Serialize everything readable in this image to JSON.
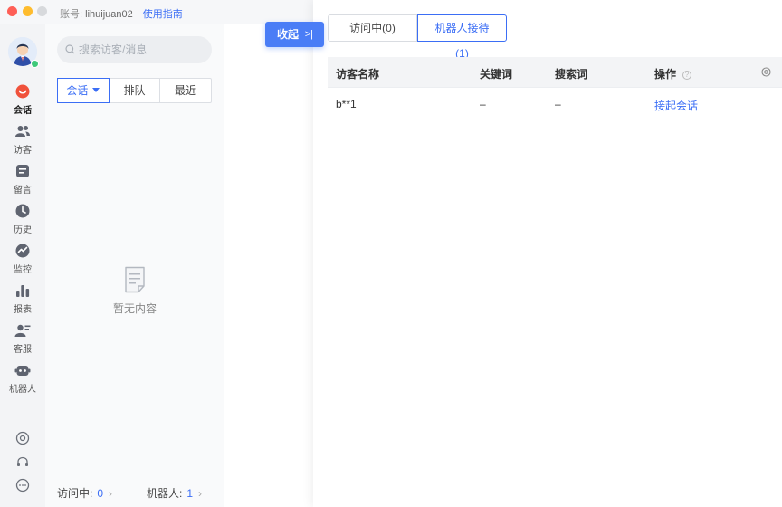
{
  "titlebar": {
    "account_label": "账号:",
    "account_name": "lihuijuan02",
    "guide": "使用指南"
  },
  "nav": {
    "items": [
      {
        "label": "会话",
        "icon": "chat-icon"
      },
      {
        "label": "访客",
        "icon": "visitors-icon"
      },
      {
        "label": "留言",
        "icon": "message-icon"
      },
      {
        "label": "历史",
        "icon": "history-icon"
      },
      {
        "label": "监控",
        "icon": "monitor-icon"
      },
      {
        "label": "报表",
        "icon": "report-icon"
      },
      {
        "label": "客服",
        "icon": "agent-icon"
      },
      {
        "label": "机器人",
        "icon": "robot-icon"
      }
    ],
    "bottom_icons": [
      "settings-icon",
      "headset-icon",
      "more-icon"
    ]
  },
  "list": {
    "search_placeholder": "搜索访客/消息",
    "tabs": [
      "会话",
      "排队",
      "最近"
    ],
    "empty_text": "暂无内容",
    "footer": {
      "visiting_label": "访问中:",
      "visiting_count": "0",
      "robot_label": "机器人:",
      "robot_count": "1"
    }
  },
  "collapse": {
    "label": "收起",
    "arrow": ">|"
  },
  "panel": {
    "tabs": [
      "访问中(0)",
      "机器人接待(1)"
    ],
    "columns": [
      "访客名称",
      "关键词",
      "搜索词",
      "操作"
    ],
    "rows": [
      {
        "name": "b**1",
        "keyword": "–",
        "search": "–",
        "action": "接起会话"
      }
    ]
  },
  "colors": {
    "accent": "#3b6ef5",
    "button": "#4a7df6",
    "online": "#3ec97a",
    "chat_active": "#f0523c"
  }
}
